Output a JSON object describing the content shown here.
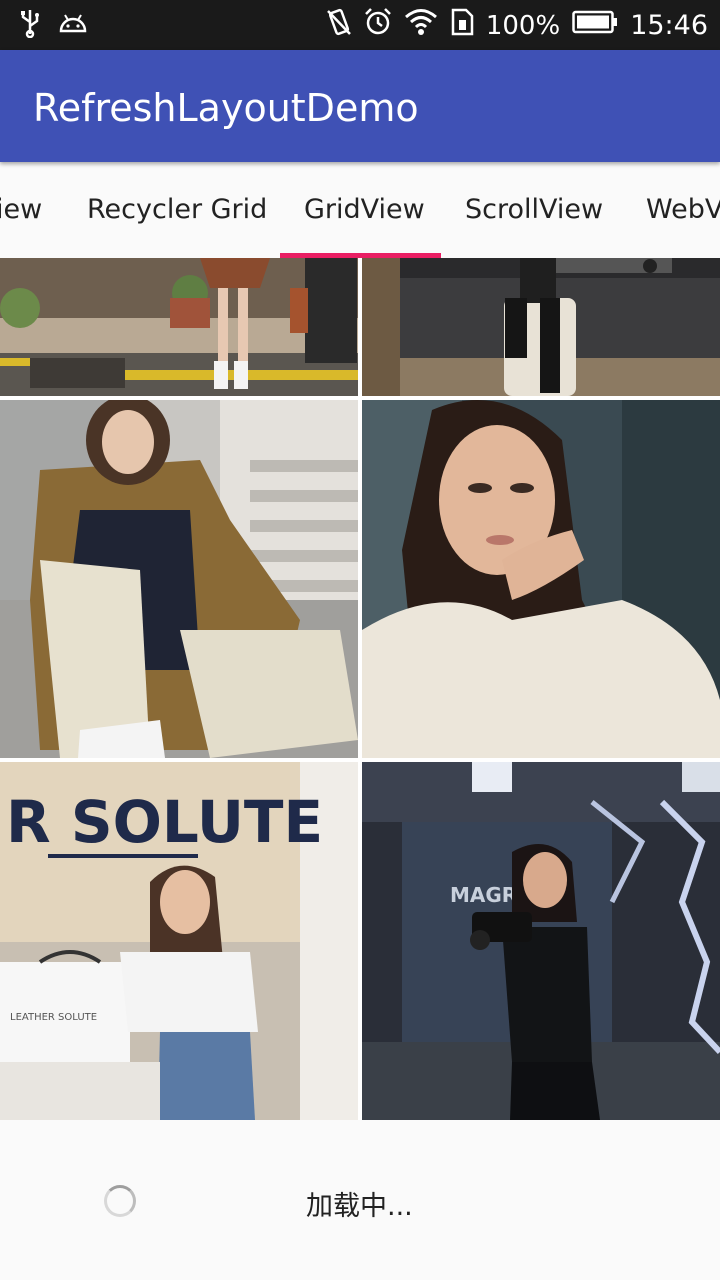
{
  "status_bar": {
    "battery_percent": "100%",
    "time": "15:46",
    "icons": [
      "usb-icon",
      "android-icon",
      "vibrate-icon",
      "alarm-icon",
      "wifi-icon",
      "sim-icon",
      "battery-icon"
    ]
  },
  "app_bar": {
    "title": "RefreshLayoutDemo",
    "color": "#3f51b5"
  },
  "tabs": [
    {
      "label": "iew"
    },
    {
      "label": "Recycler Grid"
    },
    {
      "label": "GridView",
      "selected": true
    },
    {
      "label": "ScrollView"
    },
    {
      "label": "WebV"
    }
  ],
  "tab_indicator_color": "#e91e63",
  "grid": {
    "items": [
      {
        "description": "street-photo-top-left"
      },
      {
        "description": "street-photo-top-right"
      },
      {
        "description": "trench-coat-photo"
      },
      {
        "description": "portrait-photo"
      },
      {
        "description": "storefront-photo"
      },
      {
        "description": "camera-photo"
      }
    ],
    "storefront_sign": "R SOLUTE",
    "bag_text": "LEATHER SOLUTE"
  },
  "footer": {
    "loading_label": "加载中..."
  }
}
